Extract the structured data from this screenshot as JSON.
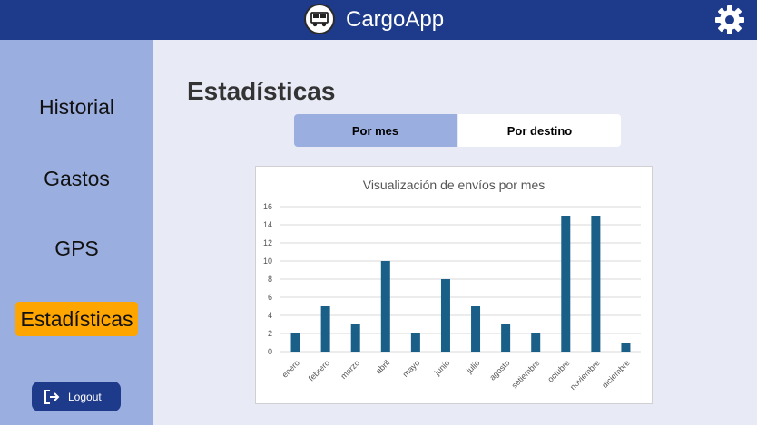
{
  "header": {
    "title": "CargoApp",
    "logo_icon": "truck-icon",
    "settings_icon": "gear-icon",
    "bg_color": "#1e3a8a"
  },
  "sidebar": {
    "items": [
      {
        "label": "Historial"
      },
      {
        "label": "Gastos"
      },
      {
        "label": "GPS"
      },
      {
        "label": "Estadísticas",
        "active": true
      }
    ],
    "logout_label": "Logout",
    "bg_color": "#9baee0",
    "active_color": "#ffa500"
  },
  "main": {
    "title": "Estadísticas",
    "tabs": [
      {
        "label": "Por mes",
        "selected": true
      },
      {
        "label": "Por destino",
        "selected": false
      }
    ]
  },
  "chart_data": {
    "type": "bar",
    "title": "Visualización de envíos por mes",
    "categories": [
      "enero",
      "febrero",
      "marzo",
      "abril",
      "mayo",
      "junio",
      "julio",
      "agosto",
      "setiembre",
      "octubre",
      "noviembre",
      "diciembre"
    ],
    "values": [
      2,
      5,
      3,
      10,
      2,
      8,
      5,
      3,
      2,
      15,
      15,
      1
    ],
    "yticks": [
      "0",
      "2",
      "4",
      "6",
      "8",
      "10",
      "12",
      "14",
      "16"
    ],
    "ylim": [
      0,
      16
    ],
    "grid": true,
    "bar_color": "#1a5f87"
  }
}
